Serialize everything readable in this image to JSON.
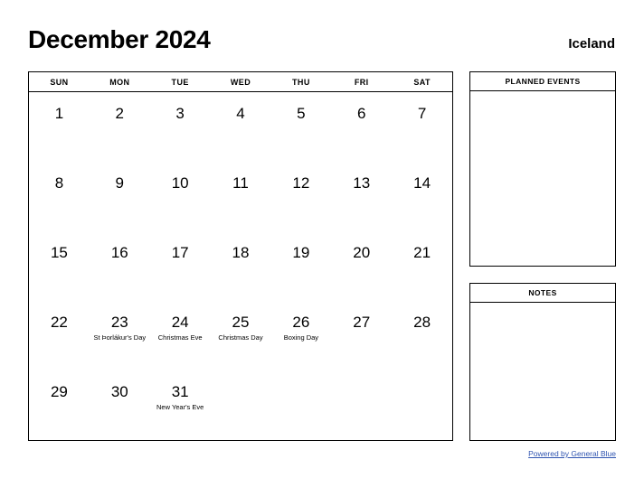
{
  "header": {
    "month_title": "December 2024",
    "country": "Iceland"
  },
  "calendar": {
    "weekdays": [
      "SUN",
      "MON",
      "TUE",
      "WED",
      "THU",
      "FRI",
      "SAT"
    ],
    "weeks": [
      [
        {
          "day": "1",
          "event": ""
        },
        {
          "day": "2",
          "event": ""
        },
        {
          "day": "3",
          "event": ""
        },
        {
          "day": "4",
          "event": ""
        },
        {
          "day": "5",
          "event": ""
        },
        {
          "day": "6",
          "event": ""
        },
        {
          "day": "7",
          "event": ""
        }
      ],
      [
        {
          "day": "8",
          "event": ""
        },
        {
          "day": "9",
          "event": ""
        },
        {
          "day": "10",
          "event": ""
        },
        {
          "day": "11",
          "event": ""
        },
        {
          "day": "12",
          "event": ""
        },
        {
          "day": "13",
          "event": ""
        },
        {
          "day": "14",
          "event": ""
        }
      ],
      [
        {
          "day": "15",
          "event": ""
        },
        {
          "day": "16",
          "event": ""
        },
        {
          "day": "17",
          "event": ""
        },
        {
          "day": "18",
          "event": ""
        },
        {
          "day": "19",
          "event": ""
        },
        {
          "day": "20",
          "event": ""
        },
        {
          "day": "21",
          "event": ""
        }
      ],
      [
        {
          "day": "22",
          "event": ""
        },
        {
          "day": "23",
          "event": "St Þorlákur's Day"
        },
        {
          "day": "24",
          "event": "Christmas Eve"
        },
        {
          "day": "25",
          "event": "Christmas Day"
        },
        {
          "day": "26",
          "event": "Boxing Day"
        },
        {
          "day": "27",
          "event": ""
        },
        {
          "day": "28",
          "event": ""
        }
      ],
      [
        {
          "day": "29",
          "event": ""
        },
        {
          "day": "30",
          "event": ""
        },
        {
          "day": "31",
          "event": "New Year's Eve"
        },
        {
          "day": "",
          "event": ""
        },
        {
          "day": "",
          "event": ""
        },
        {
          "day": "",
          "event": ""
        },
        {
          "day": "",
          "event": ""
        }
      ]
    ]
  },
  "panels": {
    "planned_events": {
      "title": "PLANNED EVENTS",
      "content": ""
    },
    "notes": {
      "title": "NOTES",
      "content": ""
    }
  },
  "footer": {
    "link_text": "Powered by General Blue",
    "link_color": "#2f54b0"
  }
}
